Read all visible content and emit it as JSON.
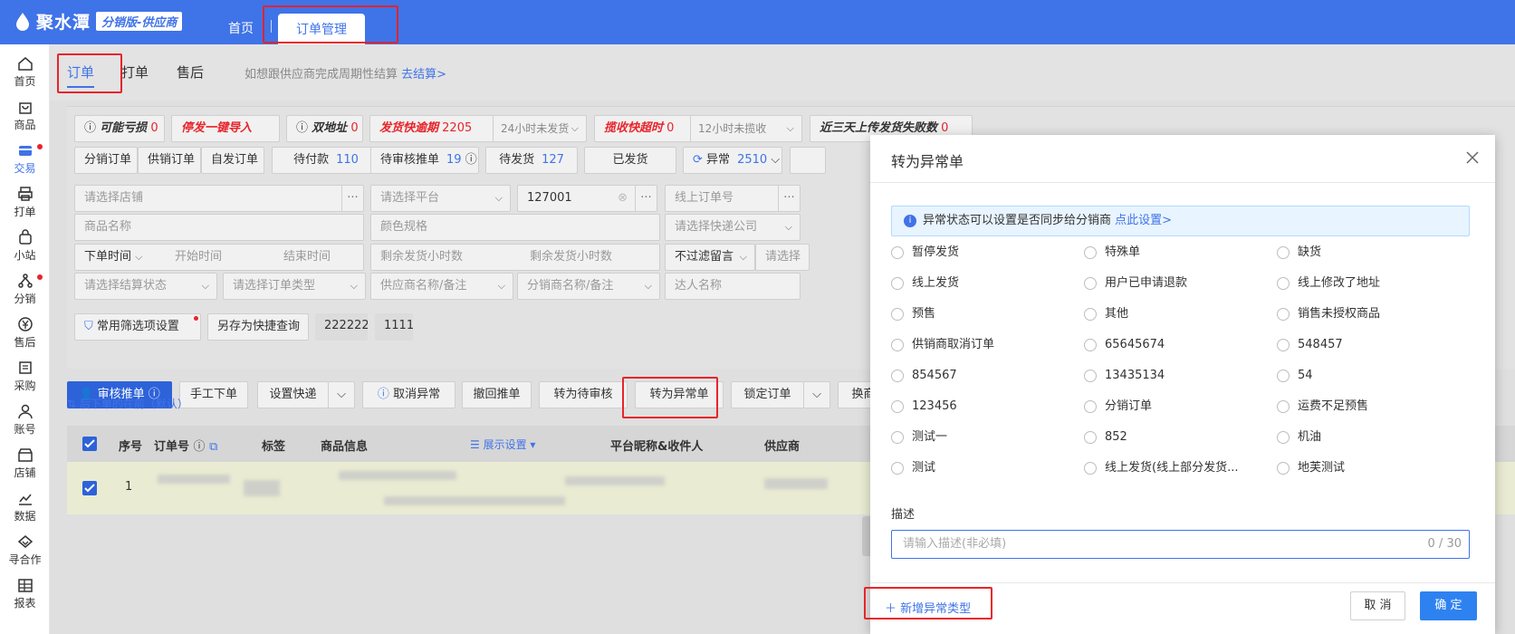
{
  "app": {
    "name": "聚水潭",
    "badge": "分销版-供应商"
  },
  "topnav": {
    "home": "首页",
    "active_tab": "订单管理"
  },
  "sidebar": {
    "items": [
      {
        "label": "首页",
        "icon": "home-icon",
        "dot": false,
        "active": false
      },
      {
        "label": "商品",
        "icon": "bag-icon",
        "dot": false,
        "active": false
      },
      {
        "label": "交易",
        "icon": "card-icon",
        "dot": true,
        "active": true
      },
      {
        "label": "打单",
        "icon": "printer-icon",
        "dot": false,
        "active": false
      },
      {
        "label": "小站",
        "icon": "shop-bag-icon",
        "dot": false,
        "active": false
      },
      {
        "label": "分销",
        "icon": "network-icon",
        "dot": true,
        "active": false
      },
      {
        "label": "售后",
        "icon": "yen-icon",
        "dot": false,
        "active": false
      },
      {
        "label": "采购",
        "icon": "purchase-icon",
        "dot": false,
        "active": false
      },
      {
        "label": "账号",
        "icon": "user-icon",
        "dot": false,
        "active": false
      },
      {
        "label": "店铺",
        "icon": "store-icon",
        "dot": false,
        "active": false
      },
      {
        "label": "数据",
        "icon": "chart-icon",
        "dot": false,
        "active": false
      },
      {
        "label": "寻合作",
        "icon": "handshake-icon",
        "dot": false,
        "active": false
      },
      {
        "label": "报表",
        "icon": "table-icon",
        "dot": false,
        "active": false
      }
    ]
  },
  "subtabs": {
    "order": "订单",
    "print": "打单",
    "after_sale": "售后",
    "hint": "如想跟供应商完成周期性结算",
    "hint_link": "去结算>"
  },
  "alerts": {
    "may_loss": "可能亏损",
    "may_loss_count": "0",
    "stop_ship": "停发一键导入",
    "double_addr": "双地址",
    "double_addr_count": "0",
    "ship_overdue": "发货快逾期",
    "ship_overdue_count": "2205",
    "ship_overdue_sel": "24小时未发货",
    "collect_timeout": "揽收快超时",
    "collect_timeout_count": "0",
    "collect_timeout_sel": "12小时未揽收",
    "upload_fail": "近三天上传发货失败数",
    "upload_fail_count": "0"
  },
  "status": {
    "dist_order": "分销订单",
    "supply_order": "供销订单",
    "self_order": "自发订单",
    "pending_pay": "待付款",
    "pending_pay_count": "110",
    "pending_review": "待审核推单",
    "pending_review_count": "19",
    "pending_ship": "待发货",
    "pending_ship_count": "127",
    "shipped": "已发货",
    "abnormal": "异常",
    "abnormal_count": "2510"
  },
  "filters": {
    "shop_ph": "请选择店铺",
    "platform_ph": "请选择平台",
    "id_value": "127001",
    "online_order_ph": "线上订单号",
    "product_name_ph": "商品名称",
    "color_spec_ph": "颜色规格",
    "express_ph": "请选择快递公司",
    "order_time": "下单时间",
    "start_time_ph": "开始时间",
    "end_time_ph": "结束时间",
    "remain_hours_ph": "剩余发货小时数",
    "remain_hours_ph2": "剩余发货小时数",
    "message_filter": "不过滤留言",
    "choose_ph": "请选择",
    "settle_status_ph": "请选择结算状态",
    "order_type_ph": "请选择订单类型",
    "supplier_ph": "供应商名称/备注",
    "distributor_ph": "分销商名称/备注",
    "talent_ph": "达人名称",
    "common_filter_btn": "常用筛选项设置",
    "save_quick_btn": "另存为快捷查询",
    "quick1": "222222",
    "quick2": "1111"
  },
  "actions": {
    "review_push": "审核推单",
    "manual_order": "手工下单",
    "set_express": "设置快递",
    "cancel_abnormal": "取消异常",
    "revoke_push": "撤回推单",
    "to_pending_review": "转为待审核",
    "to_abnormal": "转为异常单",
    "lock_order": "锁定订单",
    "change_product": "换商品",
    "sort_hint": "后下单的在前（默认）"
  },
  "table": {
    "headers": {
      "seq": "序号",
      "order_no": "订单号",
      "tag": "标签",
      "product_info": "商品信息",
      "display_settings": "展示设置",
      "receiver": "平台昵称&收件人",
      "supplier": "供应商"
    },
    "rows": [
      {
        "seq": "1"
      }
    ]
  },
  "modal": {
    "title": "转为异常单",
    "info": "异常状态可以设置是否同步给分销商",
    "info_link": "点此设置>",
    "options": [
      "暂停发货",
      "特殊单",
      "缺货",
      "线上发货",
      "用户已申请退款",
      "线上修改了地址",
      "预售",
      "其他",
      "销售未授权商品",
      "供销商取消订单",
      "65645674",
      "548457",
      "854567",
      "13435134",
      "54",
      "123456",
      "分销订单",
      "运费不足预售",
      "测试一",
      "852",
      "机油",
      "测试",
      "线上发货(线上部分发货...",
      "地芙测试"
    ],
    "desc_label": "描述",
    "desc_placeholder": "请输入描述(非必填)",
    "desc_count": "0 / 30",
    "add_type": "新增异常类型",
    "cancel": "取 消",
    "ok": "确 定"
  },
  "colors": {
    "brand": "#3f73e8",
    "primary_btn": "#2e82f0",
    "highlight": "#e8242b"
  }
}
